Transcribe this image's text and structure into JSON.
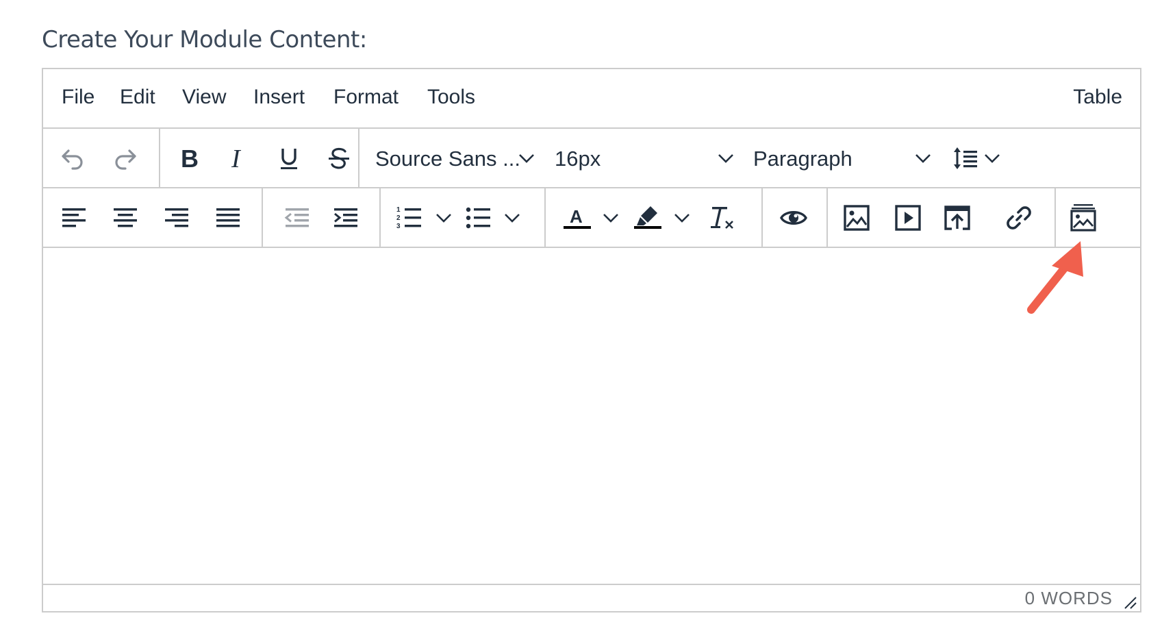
{
  "heading": "Create Your Module Content:",
  "menubar": {
    "items": [
      "File",
      "Edit",
      "View",
      "Insert",
      "Format",
      "Tools"
    ],
    "right_item": "Table"
  },
  "toolbar": {
    "font_family": "Source Sans ...",
    "font_size": "16px",
    "block_format": "Paragraph",
    "icons_row1": [
      "undo-icon",
      "redo-icon",
      "bold-icon",
      "italic-icon",
      "underline-icon",
      "strikethrough-icon",
      "line-height-icon"
    ],
    "icons_row2": [
      "align-left-icon",
      "align-center-icon",
      "align-right-icon",
      "align-justify-icon",
      "outdent-icon",
      "indent-icon",
      "numbered-list-icon",
      "bullet-list-icon",
      "text-color-icon",
      "highlight-icon",
      "clear-format-icon",
      "preview-icon",
      "image-icon",
      "media-icon",
      "upload-icon",
      "link-icon",
      "image-gallery-icon"
    ]
  },
  "statusbar": {
    "word_count": "0 WORDS"
  },
  "colors": {
    "annotation_arrow": "#f0604d",
    "border": "#cccccc",
    "icon": "#222f3e"
  }
}
